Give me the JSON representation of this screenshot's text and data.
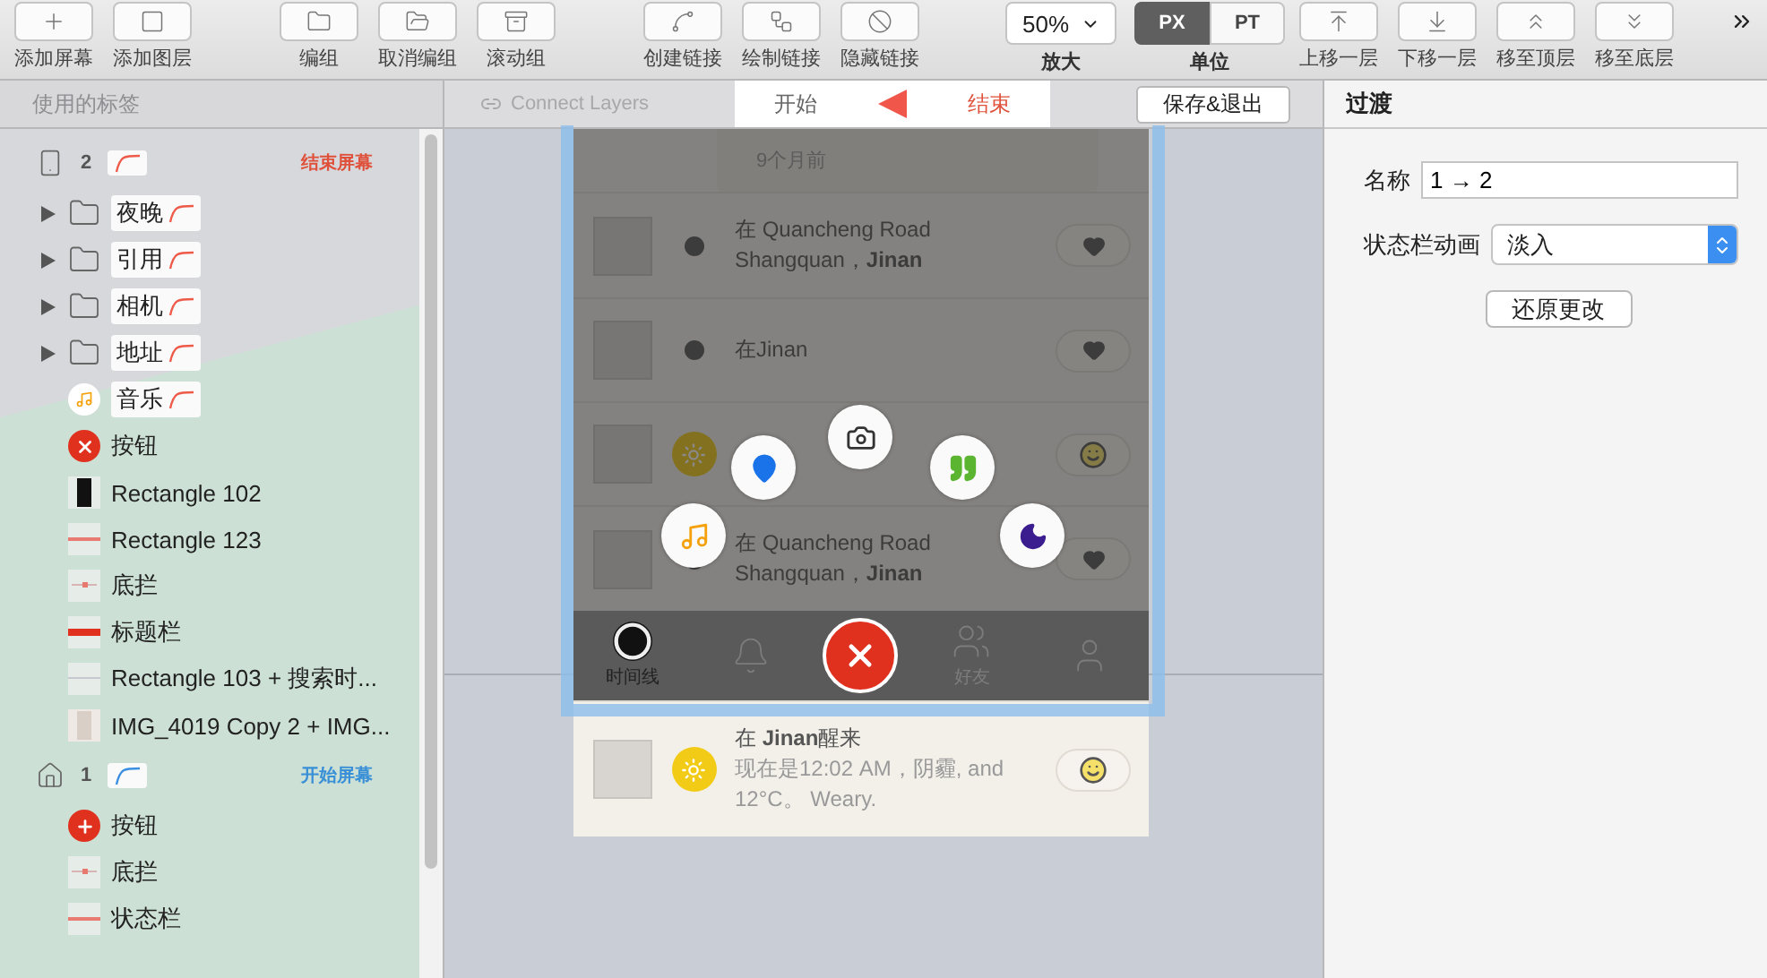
{
  "toolbar": {
    "layer_buttons": [
      {
        "label": "添加屏幕"
      },
      {
        "label": "添加图层"
      }
    ],
    "group_buttons": [
      {
        "label": "编组"
      },
      {
        "label": "取消编组"
      },
      {
        "label": "滚动组"
      }
    ],
    "link_buttons": [
      {
        "label": "创建链接"
      },
      {
        "label": "绘制链接"
      },
      {
        "label": "隐藏链接"
      }
    ],
    "zoom": {
      "value": "50%",
      "label": "放大"
    },
    "units": {
      "label": "单位",
      "options": [
        {
          "label": "PX",
          "selected": true
        },
        {
          "label": "PT",
          "selected": false
        }
      ]
    },
    "arrange_buttons": [
      {
        "label": "上移一层"
      },
      {
        "label": "下移一层"
      },
      {
        "label": "移至顶层"
      },
      {
        "label": "移至底层"
      }
    ]
  },
  "layers_panel": {
    "header": "使用的标签",
    "screens": [
      {
        "number": "2",
        "role": "结束屏幕",
        "kind": "end",
        "items": [
          {
            "kind": "folder",
            "name": "夜晚",
            "transition": true,
            "expanded": false
          },
          {
            "kind": "folder",
            "name": "引用",
            "transition": true,
            "expanded": false
          },
          {
            "kind": "folder",
            "name": "相机",
            "transition": true,
            "expanded": false
          },
          {
            "kind": "folder",
            "name": "地址",
            "transition": true,
            "expanded": false
          },
          {
            "kind": "music",
            "name": "音乐",
            "transition": true
          },
          {
            "kind": "close",
            "name": "按钮",
            "transition": false
          },
          {
            "kind": "dark-rect",
            "name": "Rectangle 102",
            "transition": false
          },
          {
            "kind": "line",
            "name": "Rectangle 123",
            "transition": false
          },
          {
            "kind": "dots",
            "name": "底拦",
            "transition": false
          },
          {
            "kind": "bar",
            "name": "标题栏",
            "transition": false
          },
          {
            "kind": "light-line",
            "name": "Rectangle 103 + 搜索时...",
            "transition": false
          },
          {
            "kind": "photo",
            "name": "IMG_4019 Copy 2 + IMG...",
            "transition": false
          }
        ]
      },
      {
        "number": "1",
        "role": "开始屏幕",
        "kind": "start",
        "items": [
          {
            "kind": "add",
            "name": "按钮",
            "transition": false
          },
          {
            "kind": "dots",
            "name": "底拦",
            "transition": false
          },
          {
            "kind": "line",
            "name": "状态栏",
            "transition": false
          }
        ]
      }
    ]
  },
  "canvas": {
    "connect": {
      "label": "Connect Layers",
      "disabled": true
    },
    "flow_tabs": [
      {
        "label": "开始",
        "selected": false
      },
      {
        "label": "结束",
        "selected": true
      }
    ],
    "save_button": "保存&退出",
    "phone": {
      "top_card": "9个月前",
      "feed": [
        {
          "kind": "location",
          "lines": [
            "在 Quancheng Road",
            "Shangquan，**Jinan**"
          ]
        },
        {
          "kind": "location",
          "lines": [
            "在Jinan"
          ]
        },
        {
          "kind": "weather"
        },
        {
          "kind": "location",
          "lines": [
            "在 Quancheng Road",
            "Shangquan，**Jinan**"
          ]
        }
      ],
      "menu": {
        "open": true
      },
      "tab_bar": [
        {
          "label": "时间线",
          "selected": true
        },
        {
          "selected": false
        },
        {
          "label": "好友",
          "selected": false
        },
        {
          "selected": false
        }
      ],
      "below": [
        {
          "kind": "weather",
          "lines": [
            "在 **Jinan**醒来",
            "现在是12:02 AM，阴霾, and",
            "12°C。 Weary."
          ]
        }
      ]
    }
  },
  "inspector": {
    "title": "过渡",
    "name_field": {
      "label": "名称",
      "value": "1 → 2"
    },
    "status_animation": {
      "label": "状态栏动画",
      "value": "淡入"
    },
    "revert_button": "还原更改"
  }
}
